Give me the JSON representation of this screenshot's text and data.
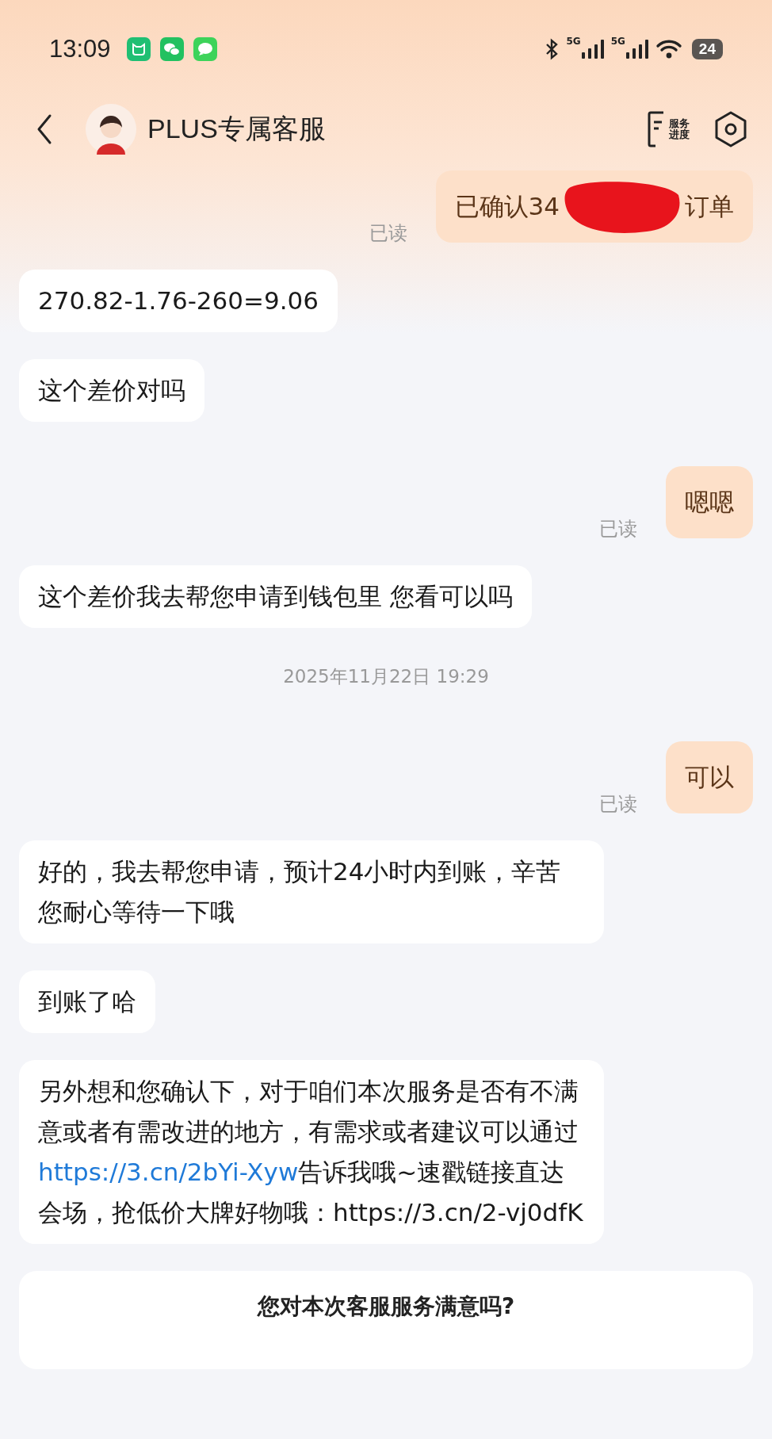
{
  "status_bar": {
    "time": "13:09",
    "network_labels": [
      "5G",
      "5G"
    ],
    "battery": "24"
  },
  "header": {
    "title": "PLUS专属客服",
    "service_button": [
      "服务",
      "进度"
    ]
  },
  "messages": [
    {
      "kind": "sent",
      "redacted": true,
      "parts": [
        {
          "text": "已确认34"
        },
        {
          "text": "订单"
        }
      ],
      "receipt": "已读"
    },
    {
      "kind": "received",
      "parts": [
        {
          "text": "270.82-1.76-260=9.06"
        }
      ]
    },
    {
      "kind": "received",
      "parts": [
        {
          "text": "这个差价对吗"
        }
      ]
    },
    {
      "kind": "sent",
      "redacted": false,
      "parts": [
        {
          "text": "嗯嗯"
        }
      ],
      "receipt": "已读"
    },
    {
      "kind": "received",
      "parts": [
        {
          "text": "这个差价我去帮您申请到钱包里 您看可以吗"
        }
      ]
    },
    {
      "kind": "timestamp",
      "text": "2025年11月22日 19:29"
    },
    {
      "kind": "sent",
      "redacted": false,
      "parts": [
        {
          "text": "可以"
        }
      ],
      "receipt": "已读"
    },
    {
      "kind": "received",
      "parts": [
        {
          "text": "好的，我去帮您申请，预计24小时内到账，辛苦您耐心等待一下哦"
        }
      ]
    },
    {
      "kind": "received",
      "parts": [
        {
          "text": "到账了哈"
        }
      ]
    },
    {
      "kind": "received",
      "parts": [
        {
          "text": "另外想和您确认下，对于咱们本次服务是否有不满意或者有需改进的地方，有需求或者建议可以通过 "
        },
        {
          "text": "https://3.cn/2bYi-Xyw",
          "kind": "link"
        },
        {
          "text": "告诉我哦~速戳链接直达会场，抢低价大牌好物哦：https://3.cn/2-vj0dfK"
        }
      ]
    }
  ],
  "survey": {
    "title": "您对本次客服服务满意吗?"
  }
}
